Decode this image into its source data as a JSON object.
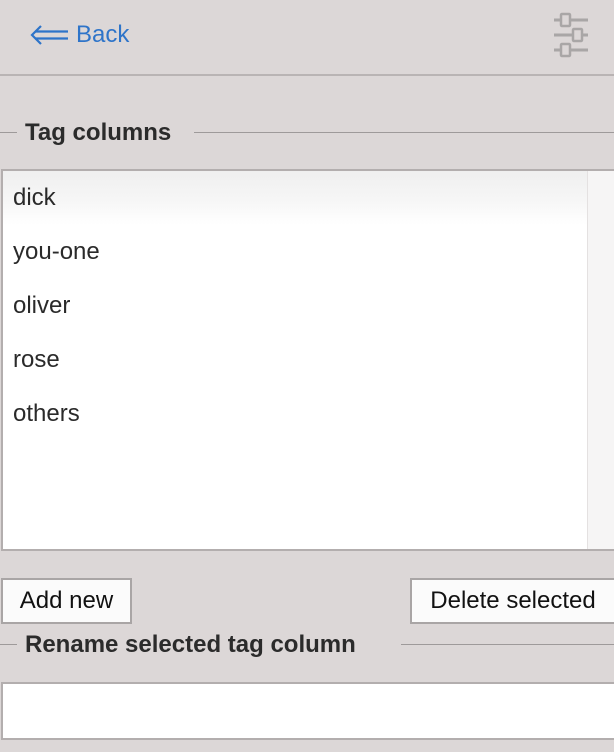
{
  "header": {
    "back_label": "Back",
    "back_icon": "left-double-arrow-icon",
    "settings_icon": "sliders-icon",
    "link_color": "#2e74c9"
  },
  "tag_columns": {
    "legend": "Tag columns",
    "items": [
      {
        "label": "dick"
      },
      {
        "label": "you-one"
      },
      {
        "label": "oliver"
      },
      {
        "label": "rose"
      },
      {
        "label": "others"
      }
    ]
  },
  "actions": {
    "add_label": "Add new",
    "delete_label": "Delete selected"
  },
  "rename": {
    "legend": "Rename selected tag column",
    "value": "",
    "placeholder": ""
  }
}
